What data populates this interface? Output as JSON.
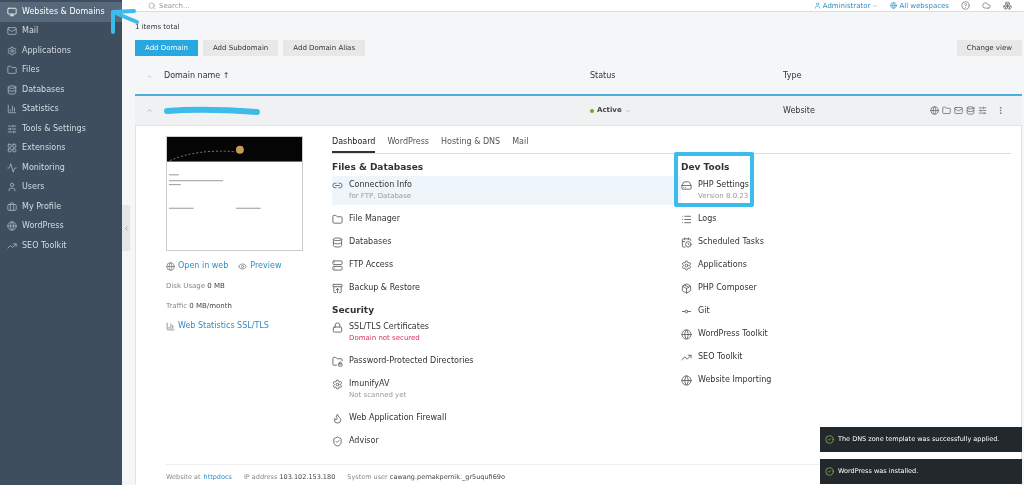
{
  "sidebar": {
    "items": [
      {
        "label": "Websites & Domains",
        "selected": true
      },
      {
        "label": "Mail",
        "selected": false
      },
      {
        "label": "Applications",
        "selected": false
      },
      {
        "label": "Files",
        "selected": false
      },
      {
        "label": "Databases",
        "selected": false
      },
      {
        "label": "Statistics",
        "selected": false
      },
      {
        "label": "Tools & Settings",
        "selected": false
      },
      {
        "label": "Extensions",
        "selected": false
      },
      {
        "label": "Monitoring",
        "selected": false
      },
      {
        "label": "Users",
        "selected": false
      },
      {
        "label": "My Profile",
        "selected": false
      },
      {
        "label": "WordPress",
        "selected": false
      },
      {
        "label": "SEO Toolkit",
        "selected": false
      }
    ]
  },
  "header": {
    "search_placeholder": "Search...",
    "user": "Administrator",
    "webspaces": "All webspaces"
  },
  "items_total": "1 items total",
  "toolbar": {
    "buttons": [
      {
        "label": "Add Domain",
        "primary": true
      },
      {
        "label": "Add Subdomain",
        "primary": false
      },
      {
        "label": "Add Domain Alias",
        "primary": false
      }
    ],
    "change_view": "Change view"
  },
  "table": {
    "columns": [
      "Domain name ↑",
      "Status",
      "Type"
    ],
    "row": {
      "status": "Active",
      "type": "Website",
      "expanded": true
    }
  },
  "panel": {
    "open_in_web": "Open in web",
    "preview": "Preview",
    "disk_usage": {
      "label": "Disk Usage",
      "value": "0 MB"
    },
    "traffic": {
      "label": "Traffic",
      "value": "0 MB/month"
    },
    "web_statistics": "Web Statistics SSL/TLS",
    "tabs": [
      {
        "label": "Dashboard",
        "selected": true
      },
      {
        "label": "WordPress",
        "selected": false
      },
      {
        "label": "Hosting & DNS",
        "selected": false
      },
      {
        "label": "Mail",
        "selected": false
      }
    ],
    "files_databases": {
      "title": "Files & Databases",
      "items": [
        {
          "label": "Connection Info",
          "sub": "for FTP, Database",
          "highlighted": true
        },
        {
          "label": "File Manager",
          "highlighted": false
        },
        {
          "label": "Databases",
          "highlighted": false
        },
        {
          "label": "FTP Access",
          "highlighted": false
        },
        {
          "label": "Backup & Restore",
          "highlighted": false
        }
      ]
    },
    "security": {
      "title": "Security",
      "items": [
        {
          "label": "SSL/TLS Certificates",
          "sub": "Domain not secured",
          "sub_warning": true
        },
        {
          "label": "Password-Protected Directories"
        },
        {
          "label": "ImunifyAV",
          "sub": "Not scanned yet",
          "sub_warning": false
        },
        {
          "label": "Web Application Firewall"
        },
        {
          "label": "Advisor"
        }
      ]
    },
    "dev_tools": {
      "title": "Dev Tools",
      "items": [
        {
          "label": "PHP Settings",
          "sub": "Version 8.0.23"
        },
        {
          "label": "Logs"
        },
        {
          "label": "Scheduled Tasks"
        },
        {
          "label": "Applications"
        },
        {
          "label": "PHP Composer"
        },
        {
          "label": "Git"
        },
        {
          "label": "WordPress Toolkit"
        },
        {
          "label": "SEO Toolkit"
        },
        {
          "label": "Website Importing"
        }
      ]
    },
    "footer": {
      "website_at_label": "Website at",
      "website_at_link": "httpdocs",
      "ip_label": "IP address",
      "ip": "103.102.153.180",
      "user_label": "System user",
      "user": "cawang.pernakpernik._gr5uqufi69o"
    }
  },
  "toasts": [
    "The DNS zone template was successfully applied.",
    "WordPress was installed."
  ]
}
